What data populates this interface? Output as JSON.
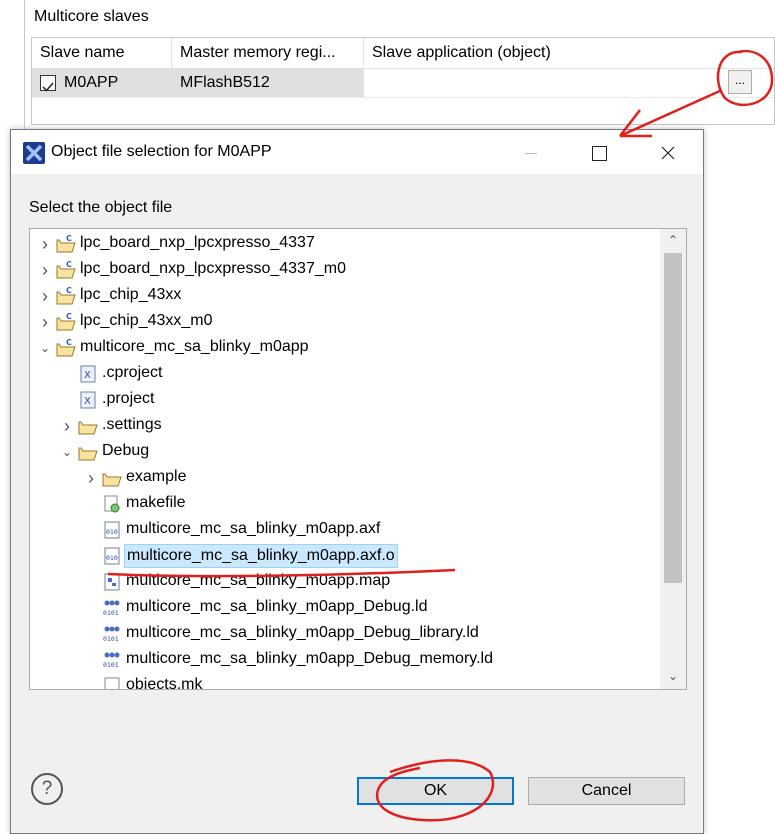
{
  "panel": {
    "section_title": "Multicore slaves",
    "columns": [
      "Slave name",
      "Master memory regi...",
      "Slave application (object)"
    ],
    "row": {
      "checked": true,
      "slave_name": "M0APP",
      "memory_region": "MFlashB512",
      "application": ""
    },
    "browse_label": "..."
  },
  "dialog": {
    "title": "Object file selection for M0APP",
    "prompt": "Select the object file",
    "tree": [
      {
        "label": "lpc_board_nxp_lpcxpresso_4337",
        "icon": "c-project-folder-icon",
        "expander": "collapsed",
        "level": 0
      },
      {
        "label": "lpc_board_nxp_lpcxpresso_4337_m0",
        "icon": "c-project-folder-icon",
        "expander": "collapsed",
        "level": 0
      },
      {
        "label": "lpc_chip_43xx",
        "icon": "c-project-folder-icon",
        "expander": "collapsed",
        "level": 0
      },
      {
        "label": "lpc_chip_43xx_m0",
        "icon": "c-project-folder-icon",
        "expander": "collapsed",
        "level": 0
      },
      {
        "label": "multicore_mc_sa_blinky_m0app",
        "icon": "c-project-folder-icon",
        "expander": "expanded",
        "level": 0
      },
      {
        "label": ".cproject",
        "icon": "xml-file-icon",
        "expander": "none",
        "level": 1
      },
      {
        "label": ".project",
        "icon": "xml-file-icon",
        "expander": "none",
        "level": 1
      },
      {
        "label": ".settings",
        "icon": "folder-icon",
        "expander": "collapsed",
        "level": 1
      },
      {
        "label": "Debug",
        "icon": "folder-icon",
        "expander": "expanded",
        "level": 1
      },
      {
        "label": "example",
        "icon": "folder-icon",
        "expander": "collapsed",
        "level": 2
      },
      {
        "label": "makefile",
        "icon": "makefile-icon",
        "expander": "none",
        "level": 2
      },
      {
        "label": "multicore_mc_sa_blinky_m0app.axf",
        "icon": "binary-file-icon",
        "expander": "none",
        "level": 2
      },
      {
        "label": "multicore_mc_sa_blinky_m0app.axf.o",
        "icon": "binary-file-icon",
        "expander": "none",
        "level": 2,
        "selected": true
      },
      {
        "label": "multicore_mc_sa_blinky_m0app.map",
        "icon": "map-file-icon",
        "expander": "none",
        "level": 2
      },
      {
        "label": "multicore_mc_sa_blinky_m0app_Debug.ld",
        "icon": "linker-file-icon",
        "expander": "none",
        "level": 2
      },
      {
        "label": "multicore_mc_sa_blinky_m0app_Debug_library.ld",
        "icon": "linker-file-icon",
        "expander": "none",
        "level": 2
      },
      {
        "label": "multicore_mc_sa_blinky_m0app_Debug_memory.ld",
        "icon": "linker-file-icon",
        "expander": "none",
        "level": 2
      },
      {
        "label": "objects.mk",
        "icon": "text-file-icon",
        "expander": "none",
        "level": 2
      }
    ],
    "help_label": "?",
    "ok_label": "OK",
    "cancel_label": "Cancel"
  },
  "colors": {
    "selection": "#cce8ff",
    "annotation": "#e0201c",
    "accent": "#0078d7"
  }
}
